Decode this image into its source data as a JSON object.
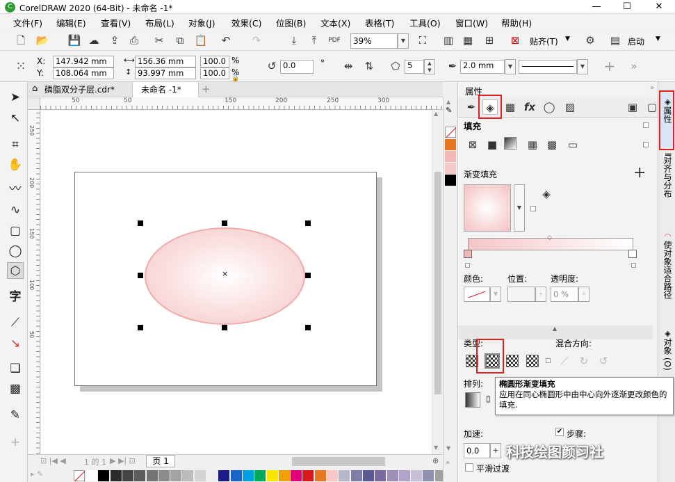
{
  "window": {
    "title": "CorelDRAW 2020 (64-Bit) - 未命名 -1*",
    "app_icon": "coreldraw-icon",
    "minimize": "—",
    "maximize": "☐",
    "close": "✕"
  },
  "menu": [
    "文件(F)",
    "编辑(E)",
    "查看(V)",
    "布局(L)",
    "对象(J)",
    "效果(C)",
    "位图(B)",
    "文本(X)",
    "表格(T)",
    "工具(O)",
    "窗口(W)",
    "帮助(H)"
  ],
  "toolbar": {
    "zoom": "39%",
    "snap_label": "贴齐(T)",
    "launch_label": "启动"
  },
  "property_bar": {
    "x_label": "X:",
    "x_value": "147.942 mm",
    "y_label": "Y:",
    "y_value": "108.064 mm",
    "w_value": "156.36 mm",
    "h_value": "93.997 mm",
    "scale_w": "100.0",
    "scale_h": "100.0",
    "percent": "%",
    "rotation": "0.0",
    "degree": "°",
    "sides": "5",
    "outline_width": "2.0 mm"
  },
  "tabs": [
    {
      "label": "磷脂双分子层.cdr*",
      "active": false
    },
    {
      "label": "未命名 -1*",
      "active": true
    }
  ],
  "ruler_top": [
    "50",
    "0",
    "50",
    "100",
    "150",
    "200",
    "250",
    "300"
  ],
  "ruler_left": [
    "250",
    "200",
    "150",
    "100",
    "50"
  ],
  "page_nav": {
    "page_counter": "1 的 1",
    "page_tab": "页 1"
  },
  "panel": {
    "title": "属性",
    "fill_header": "填充",
    "fountain_label": "渐变填充",
    "color_label": "颜色:",
    "position_label": "位置:",
    "opacity_label": "透明度:",
    "opacity_value": "0 %",
    "type_label": "类型:",
    "blend_label": "混合方向:",
    "arrange_label": "排列:",
    "accel_label": "加速:",
    "accel_value": "0.0",
    "steps_label": "步骤:",
    "smooth_label": "平滑过渡"
  },
  "tooltip": {
    "title": "椭圆形渐变填充",
    "body": "应用在同心椭圆形中由中心向外逐渐更改颜色的填充."
  },
  "dock": [
    "属性",
    "对齐与分布",
    "使对象适合路径",
    "对象 (O)"
  ],
  "colors": {
    "accent_red": "#e02020",
    "ellipse_edge": "#f2b8b8",
    "ellipse_center": "#ffffff"
  },
  "palette_bottom": [
    "#ffffff",
    "#000000",
    "#2a2a2a",
    "#444444",
    "#5c5c5c",
    "#737373",
    "#8b8b8b",
    "#a3a3a3",
    "#bcbcbc",
    "#d4d4d4",
    "#eeeeee",
    "#1b1b8a",
    "#1a63c8",
    "#00a0e0",
    "#00a859",
    "#f7e600",
    "#f2a000",
    "#e2007a",
    "#d7191c",
    "#e87722",
    "#f7c8c8",
    "#b8b8cc",
    "#7f7fa8",
    "#5a5a90",
    "#7a6aa0",
    "#9c8fb8",
    "#b0a4c8",
    "#c8c0d8",
    "#9090b0",
    "#a0a0a0"
  ],
  "palette_right": [
    "#e87722",
    "#f2b8b8",
    "#f7c8c8",
    "#000000"
  ],
  "watermark": "科技绘图颜习社"
}
